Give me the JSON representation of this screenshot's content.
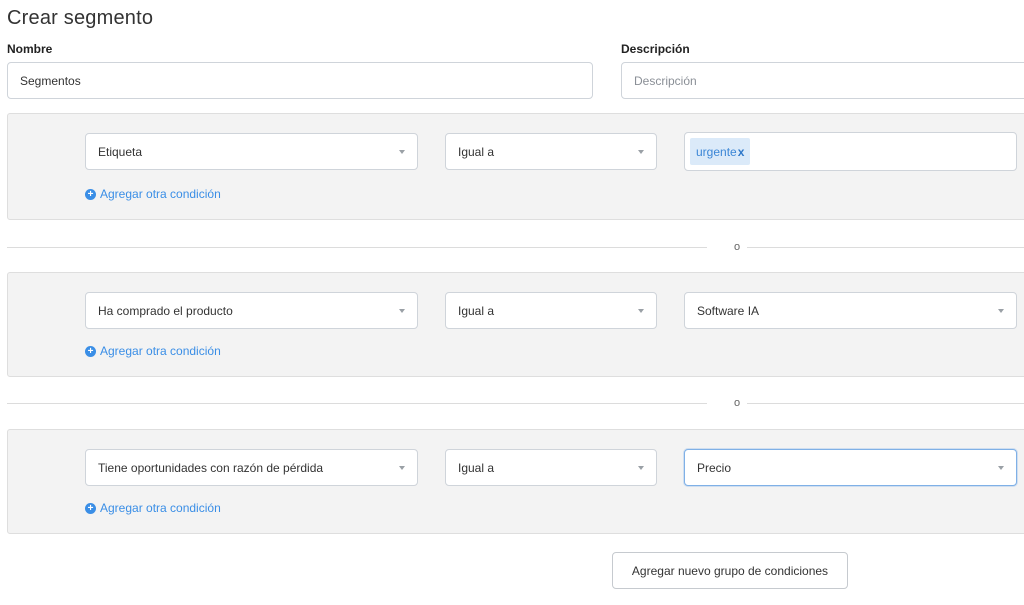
{
  "page": {
    "title": "Crear segmento"
  },
  "form": {
    "name_label": "Nombre",
    "name_value": "Segmentos",
    "description_label": "Descripción",
    "description_value": "",
    "description_placeholder": "Descripción"
  },
  "groups": [
    {
      "field": "Etiqueta",
      "operator": "Igual a",
      "value_type": "tags",
      "tags": [
        {
          "label": "urgente",
          "remove": "x"
        }
      ],
      "add_condition": "Agregar otra condición"
    },
    {
      "field": "Ha comprado el producto",
      "operator": "Igual a",
      "value_type": "select",
      "value": "Software IA",
      "add_condition": "Agregar otra condición"
    },
    {
      "field": "Tiene oportunidades con razón de pérdida",
      "operator": "Igual a",
      "value_type": "select",
      "value": "Precio",
      "add_condition": "Agregar otra condición"
    }
  ],
  "separators": [
    "o",
    "o"
  ],
  "actions": {
    "add_group": "Agregar nuevo grupo de condiciones"
  },
  "icons": {
    "caret": "chevron-down-icon",
    "add": "plus-circle-icon",
    "remove": "close-icon"
  },
  "colors": {
    "accent": "#3a8ee6",
    "tag_bg": "#dbeaf9",
    "group_bg": "#f3f3f3"
  }
}
